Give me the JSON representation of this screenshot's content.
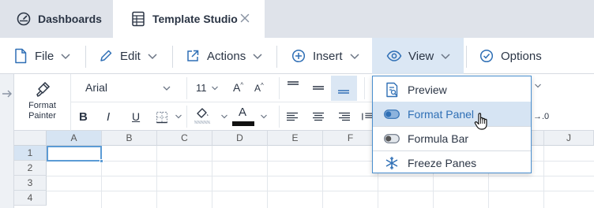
{
  "tabs": [
    {
      "label": "Dashboards",
      "icon": "dashboard-gauge-icon",
      "active": false
    },
    {
      "label": "Template Studio",
      "icon": "spreadsheet-icon",
      "active": true
    }
  ],
  "menu": [
    {
      "label": "File",
      "icon": "file-icon"
    },
    {
      "label": "Edit",
      "icon": "pencil-icon"
    },
    {
      "label": "Actions",
      "icon": "external-link-icon"
    },
    {
      "label": "Insert",
      "icon": "plus-circle-icon"
    },
    {
      "label": "View",
      "icon": "eye-icon",
      "open": true
    },
    {
      "label": "Options",
      "icon": "check-circle-icon"
    }
  ],
  "toolbar": {
    "format_painter": {
      "line1": "Format",
      "line2": "Painter"
    },
    "font_family": "Arial",
    "font_size": "11",
    "increase_font": "A",
    "decrease_font": "A",
    "font_color_letter": "A",
    "bold": "B",
    "italic": "I",
    "underline": "U",
    "decimal_label": "→.0"
  },
  "view_menu": {
    "items": [
      {
        "label": "Preview",
        "icon": "preview-icon"
      },
      {
        "label": "Format Panel",
        "icon": "toggle-on-icon",
        "hovered": true
      },
      {
        "label": "Formula Bar",
        "icon": "toggle-off-icon"
      },
      {
        "label": "Freeze Panes",
        "icon": "snowflake-icon"
      }
    ]
  },
  "grid": {
    "columns": [
      "A",
      "B",
      "C",
      "D",
      "E",
      "F",
      "J"
    ],
    "rows": [
      "1",
      "2",
      "3",
      "4"
    ],
    "selected_cell": "A1"
  },
  "colors": {
    "accent": "#2f6fb5",
    "selection": "#d6e4f3",
    "tab_bg": "#dfe3ea"
  }
}
